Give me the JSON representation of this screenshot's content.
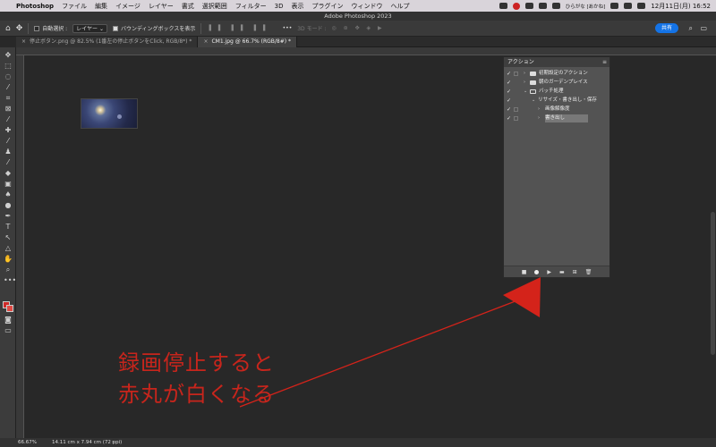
{
  "menubar": {
    "apple": "",
    "app": "Photoshop",
    "items": [
      "ファイル",
      "編集",
      "イメージ",
      "レイヤー",
      "書式",
      "選択範囲",
      "フィルター",
      "3D",
      "表示",
      "プラグイン",
      "ウィンドウ",
      "ヘルプ"
    ],
    "user": "ひらがな [あかね]",
    "clock": "12月11日(月) 16:52"
  },
  "titlebar": {
    "title": "Adobe Photoshop 2023"
  },
  "options": {
    "auto_select_label": "自動選択 :",
    "auto_select_value": "レイヤー",
    "bounding_box_label": "バウンディングボックスを表示",
    "mode_3d_label": "3D モード :",
    "share_label": "共有"
  },
  "tabs": [
    {
      "label": "停止ボタン.png @ 82.5% (1番左の停止ボタンをClick, RGB/8*) *",
      "active": false
    },
    {
      "label": "CM1.jpg @ 66.7% (RGB/8#) *",
      "active": true
    }
  ],
  "actions_panel": {
    "title": "アクション",
    "rows": [
      {
        "label": "初期設定のアクション",
        "type": "set",
        "checked": true
      },
      {
        "label": "朝のガーデンプレイス",
        "type": "set",
        "checked": true
      },
      {
        "label": "バッチ処理",
        "type": "set-open",
        "checked": true
      },
      {
        "label": "リサイズ・書き出し・保存",
        "type": "action-open",
        "checked": true
      },
      {
        "label": "画像解像度",
        "type": "step",
        "checked": true
      },
      {
        "label": "書き出し",
        "type": "step",
        "checked": true,
        "highlighted": true
      }
    ],
    "footer": [
      "stop-icon",
      "record-icon",
      "play-icon",
      "new-set-icon",
      "new-action-icon",
      "trash-icon"
    ]
  },
  "status": {
    "zoom": "66.67%",
    "doc_info": "14.11 cm x 7.94 cm (72 ppi)"
  },
  "annotation": {
    "line1": "録画停止すると",
    "line2": "赤丸が白くなる",
    "color": "#c8251c"
  },
  "colors": {
    "accent": "#1473e6",
    "annotation": "#d4231a",
    "panel": "#535353",
    "canvas": "#282828"
  }
}
